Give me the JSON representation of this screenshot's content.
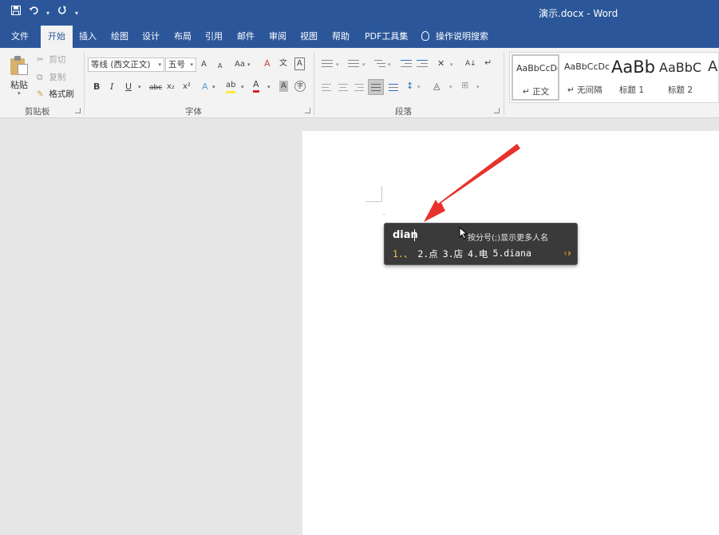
{
  "window": {
    "title": "演示.docx  -  Word",
    "qat": {
      "save_icon": "save-icon",
      "undo_icon": "undo-icon",
      "redo_icon": "redo-icon",
      "customize_icon": "chevron-down-icon"
    }
  },
  "tabs": [
    {
      "label": "文件"
    },
    {
      "label": "开始"
    },
    {
      "label": "插入"
    },
    {
      "label": "绘图"
    },
    {
      "label": "设计"
    },
    {
      "label": "布局"
    },
    {
      "label": "引用"
    },
    {
      "label": "邮件"
    },
    {
      "label": "审阅"
    },
    {
      "label": "视图"
    },
    {
      "label": "帮助"
    },
    {
      "label": "PDF工具集"
    }
  ],
  "active_tab": "开始",
  "tell_me": "操作说明搜索",
  "ribbon": {
    "clipboard": {
      "paste": "粘贴",
      "cut": "剪切",
      "copy": "复制",
      "format_painter": "格式刷",
      "label": "剪贴板"
    },
    "font": {
      "font_name": "等线 (西文正文)",
      "font_size": "五号",
      "grow": "A",
      "shrink": "A",
      "case": "Aa",
      "clear": "A",
      "phonetic": "文",
      "border": "A",
      "bold": "B",
      "italic": "I",
      "underline": "U",
      "strike": "abc",
      "sub": "x₂",
      "sup": "x²",
      "effects": "A",
      "highlight": "ab",
      "color": "A",
      "shade": "A",
      "enclose": "字",
      "label": "字体"
    },
    "paragraph": {
      "label": "段落",
      "sort": "A↓",
      "marks": "↵"
    },
    "styles": [
      {
        "preview": "AaBbCcDc",
        "name": "↵ 正文"
      },
      {
        "preview": "AaBbCcDc",
        "name": "↵ 无间隔"
      },
      {
        "preview": "AaBb",
        "name": "标题 1"
      },
      {
        "preview": "AaBbC",
        "name": "标题 2"
      },
      {
        "preview": "Aa",
        "name": ""
      }
    ]
  },
  "ime": {
    "input": "dian",
    "hint": "按分号(;)显示更多人名",
    "candidates": [
      "1.、",
      "2.点",
      "3.店",
      "4.电",
      "5.diana"
    ],
    "nav_prev": "‹",
    "nav_next": "›"
  },
  "colors": {
    "accent": "#2b579a",
    "annotation_arrow": "#e8322c",
    "ime_bg": "#3a3a3a",
    "ime_highlight": "#f2c14e"
  }
}
